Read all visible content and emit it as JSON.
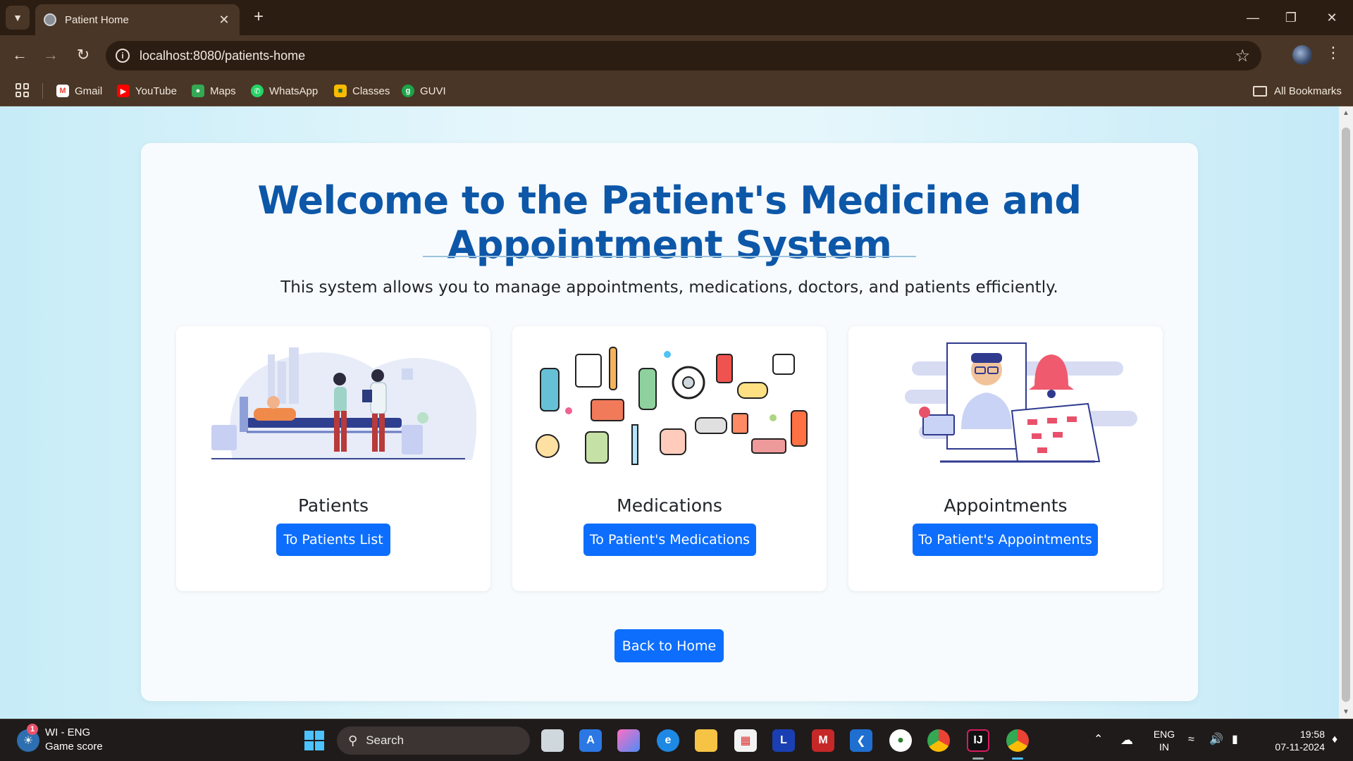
{
  "browser": {
    "tab_title": "Patient Home",
    "url": "localhost:8080/patients-home",
    "bookmarks": [
      {
        "label": "Gmail",
        "icon": "gmail-icon",
        "color": "#ea4335"
      },
      {
        "label": "YouTube",
        "icon": "youtube-icon",
        "color": "#ff0000"
      },
      {
        "label": "Maps",
        "icon": "maps-icon",
        "color": "#34a853"
      },
      {
        "label": "WhatsApp",
        "icon": "whatsapp-icon",
        "color": "#25d366"
      },
      {
        "label": "Classes",
        "icon": "classroom-icon",
        "color": "#f9bb00"
      },
      {
        "label": "GUVI",
        "icon": "guvi-icon",
        "color": "#1ea34a"
      }
    ],
    "all_bookmarks": "All Bookmarks"
  },
  "page": {
    "title": "Welcome to the Patient's Medicine and Appointment System",
    "intro": "This system allows you to manage appointments, medications, doctors, and patients efficiently.",
    "cards": [
      {
        "title": "Patients",
        "button": "To Patients List",
        "illustration": "hospital-bed-illustration"
      },
      {
        "title": "Medications",
        "button": "To Patient's Medications",
        "illustration": "medical-supplies-illustration"
      },
      {
        "title": "Appointments",
        "button": "To Patient's Appointments",
        "illustration": "doctor-calendar-illustration"
      }
    ],
    "back_button": "Back to Home",
    "accent_color": "#0d57a8",
    "button_color": "#0d6efd"
  },
  "taskbar": {
    "weather_title": "WI - ENG",
    "weather_subtitle": "Game score",
    "weather_badge": "1",
    "search_placeholder": "Search",
    "lang_top": "ENG",
    "lang_bottom": "IN",
    "time": "19:58",
    "date": "07-11-2024"
  }
}
